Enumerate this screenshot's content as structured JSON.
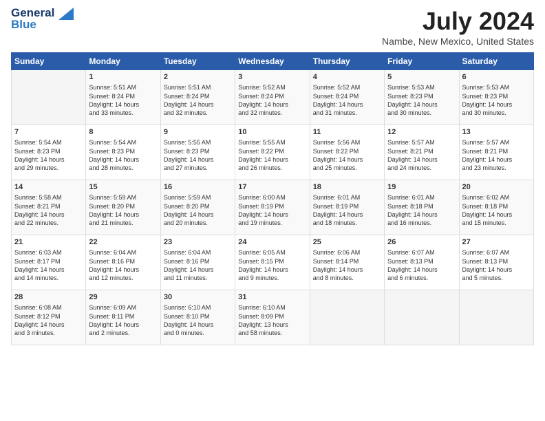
{
  "header": {
    "logo_line1": "General",
    "logo_line2": "Blue",
    "month_title": "July 2024",
    "location": "Nambe, New Mexico, United States"
  },
  "days_of_week": [
    "Sunday",
    "Monday",
    "Tuesday",
    "Wednesday",
    "Thursday",
    "Friday",
    "Saturday"
  ],
  "weeks": [
    [
      {
        "day": "",
        "info": ""
      },
      {
        "day": "1",
        "info": "Sunrise: 5:51 AM\nSunset: 8:24 PM\nDaylight: 14 hours\nand 33 minutes."
      },
      {
        "day": "2",
        "info": "Sunrise: 5:51 AM\nSunset: 8:24 PM\nDaylight: 14 hours\nand 32 minutes."
      },
      {
        "day": "3",
        "info": "Sunrise: 5:52 AM\nSunset: 8:24 PM\nDaylight: 14 hours\nand 32 minutes."
      },
      {
        "day": "4",
        "info": "Sunrise: 5:52 AM\nSunset: 8:24 PM\nDaylight: 14 hours\nand 31 minutes."
      },
      {
        "day": "5",
        "info": "Sunrise: 5:53 AM\nSunset: 8:23 PM\nDaylight: 14 hours\nand 30 minutes."
      },
      {
        "day": "6",
        "info": "Sunrise: 5:53 AM\nSunset: 8:23 PM\nDaylight: 14 hours\nand 30 minutes."
      }
    ],
    [
      {
        "day": "7",
        "info": "Sunrise: 5:54 AM\nSunset: 8:23 PM\nDaylight: 14 hours\nand 29 minutes."
      },
      {
        "day": "8",
        "info": "Sunrise: 5:54 AM\nSunset: 8:23 PM\nDaylight: 14 hours\nand 28 minutes."
      },
      {
        "day": "9",
        "info": "Sunrise: 5:55 AM\nSunset: 8:23 PM\nDaylight: 14 hours\nand 27 minutes."
      },
      {
        "day": "10",
        "info": "Sunrise: 5:55 AM\nSunset: 8:22 PM\nDaylight: 14 hours\nand 26 minutes."
      },
      {
        "day": "11",
        "info": "Sunrise: 5:56 AM\nSunset: 8:22 PM\nDaylight: 14 hours\nand 25 minutes."
      },
      {
        "day": "12",
        "info": "Sunrise: 5:57 AM\nSunset: 8:21 PM\nDaylight: 14 hours\nand 24 minutes."
      },
      {
        "day": "13",
        "info": "Sunrise: 5:57 AM\nSunset: 8:21 PM\nDaylight: 14 hours\nand 23 minutes."
      }
    ],
    [
      {
        "day": "14",
        "info": "Sunrise: 5:58 AM\nSunset: 8:21 PM\nDaylight: 14 hours\nand 22 minutes."
      },
      {
        "day": "15",
        "info": "Sunrise: 5:59 AM\nSunset: 8:20 PM\nDaylight: 14 hours\nand 21 minutes."
      },
      {
        "day": "16",
        "info": "Sunrise: 5:59 AM\nSunset: 8:20 PM\nDaylight: 14 hours\nand 20 minutes."
      },
      {
        "day": "17",
        "info": "Sunrise: 6:00 AM\nSunset: 8:19 PM\nDaylight: 14 hours\nand 19 minutes."
      },
      {
        "day": "18",
        "info": "Sunrise: 6:01 AM\nSunset: 8:19 PM\nDaylight: 14 hours\nand 18 minutes."
      },
      {
        "day": "19",
        "info": "Sunrise: 6:01 AM\nSunset: 8:18 PM\nDaylight: 14 hours\nand 16 minutes."
      },
      {
        "day": "20",
        "info": "Sunrise: 6:02 AM\nSunset: 8:18 PM\nDaylight: 14 hours\nand 15 minutes."
      }
    ],
    [
      {
        "day": "21",
        "info": "Sunrise: 6:03 AM\nSunset: 8:17 PM\nDaylight: 14 hours\nand 14 minutes."
      },
      {
        "day": "22",
        "info": "Sunrise: 6:04 AM\nSunset: 8:16 PM\nDaylight: 14 hours\nand 12 minutes."
      },
      {
        "day": "23",
        "info": "Sunrise: 6:04 AM\nSunset: 8:16 PM\nDaylight: 14 hours\nand 11 minutes."
      },
      {
        "day": "24",
        "info": "Sunrise: 6:05 AM\nSunset: 8:15 PM\nDaylight: 14 hours\nand 9 minutes."
      },
      {
        "day": "25",
        "info": "Sunrise: 6:06 AM\nSunset: 8:14 PM\nDaylight: 14 hours\nand 8 minutes."
      },
      {
        "day": "26",
        "info": "Sunrise: 6:07 AM\nSunset: 8:13 PM\nDaylight: 14 hours\nand 6 minutes."
      },
      {
        "day": "27",
        "info": "Sunrise: 6:07 AM\nSunset: 8:13 PM\nDaylight: 14 hours\nand 5 minutes."
      }
    ],
    [
      {
        "day": "28",
        "info": "Sunrise: 6:08 AM\nSunset: 8:12 PM\nDaylight: 14 hours\nand 3 minutes."
      },
      {
        "day": "29",
        "info": "Sunrise: 6:09 AM\nSunset: 8:11 PM\nDaylight: 14 hours\nand 2 minutes."
      },
      {
        "day": "30",
        "info": "Sunrise: 6:10 AM\nSunset: 8:10 PM\nDaylight: 14 hours\nand 0 minutes."
      },
      {
        "day": "31",
        "info": "Sunrise: 6:10 AM\nSunset: 8:09 PM\nDaylight: 13 hours\nand 58 minutes."
      },
      {
        "day": "",
        "info": ""
      },
      {
        "day": "",
        "info": ""
      },
      {
        "day": "",
        "info": ""
      }
    ]
  ]
}
